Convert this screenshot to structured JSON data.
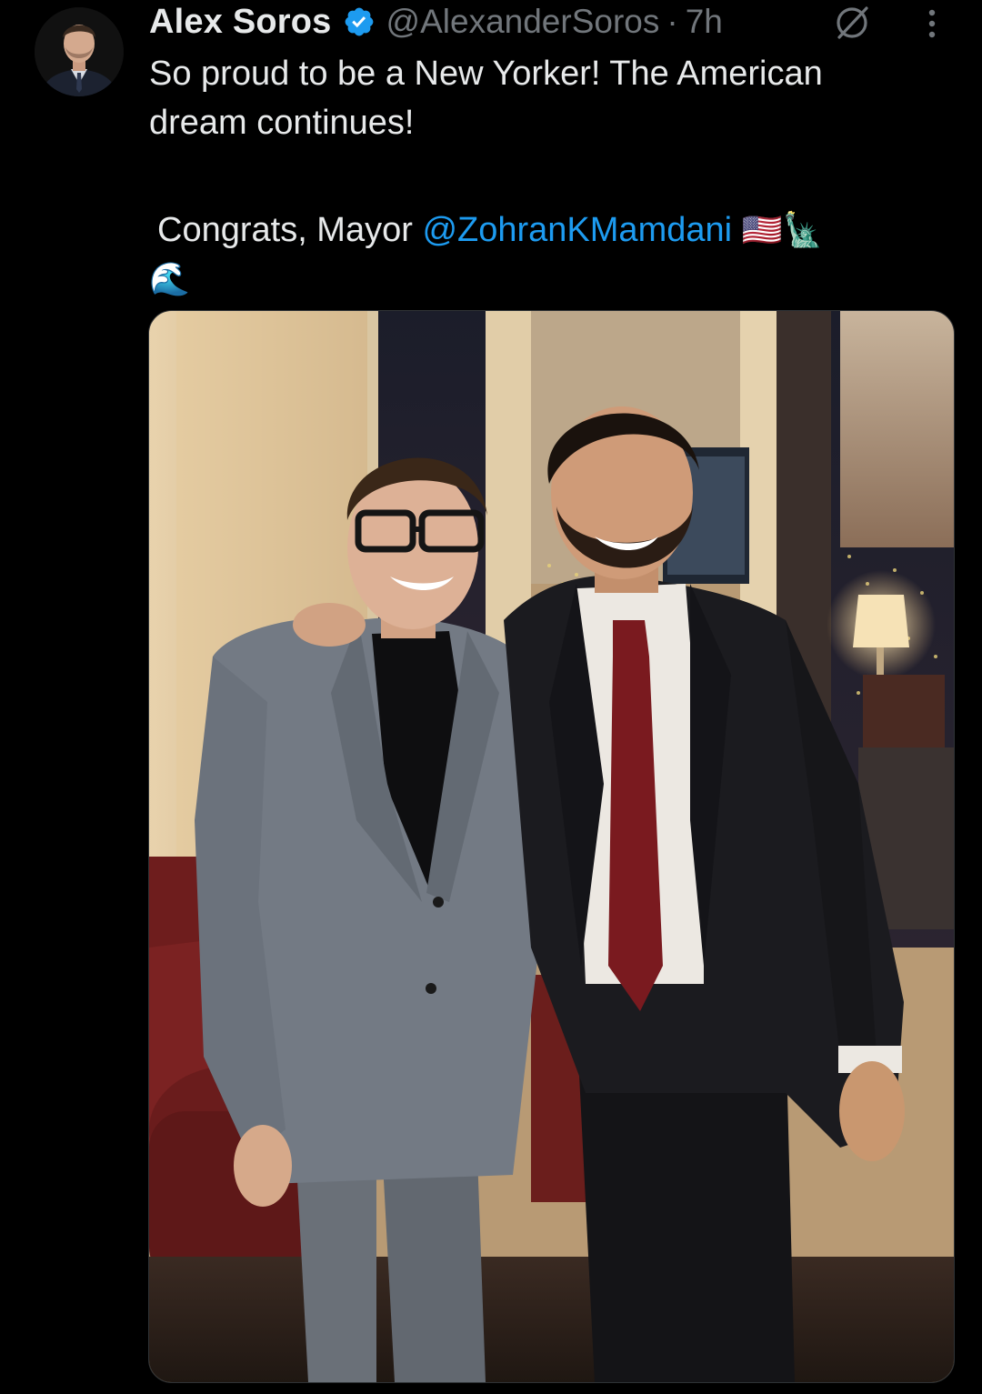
{
  "author": {
    "display_name": "Alex Soros",
    "handle": "@AlexanderSoros",
    "separator": "·",
    "time": "7h",
    "verified": true,
    "avatar_icon": "profile-photo"
  },
  "actions": {
    "grok_icon": "grok-slash-icon",
    "more_icon": "more-vertical-icon"
  },
  "tweet": {
    "line1": "So proud to be a New Yorker! The American",
    "line2": "dream continues!",
    "line3_prefix": "Congrats, Mayor ",
    "mention": "@ZohranKMamdani",
    "emoji_flag": "🇺🇸",
    "emoji_statue": "🗽",
    "emoji_wave": "🌊"
  },
  "media": {
    "type": "photo",
    "icon": "photo-two-men-posing"
  },
  "colors": {
    "background": "#000000",
    "text": "#e7e9ea",
    "muted": "#71767b",
    "link": "#1d9bf0",
    "verified": "#1d9bf0"
  }
}
